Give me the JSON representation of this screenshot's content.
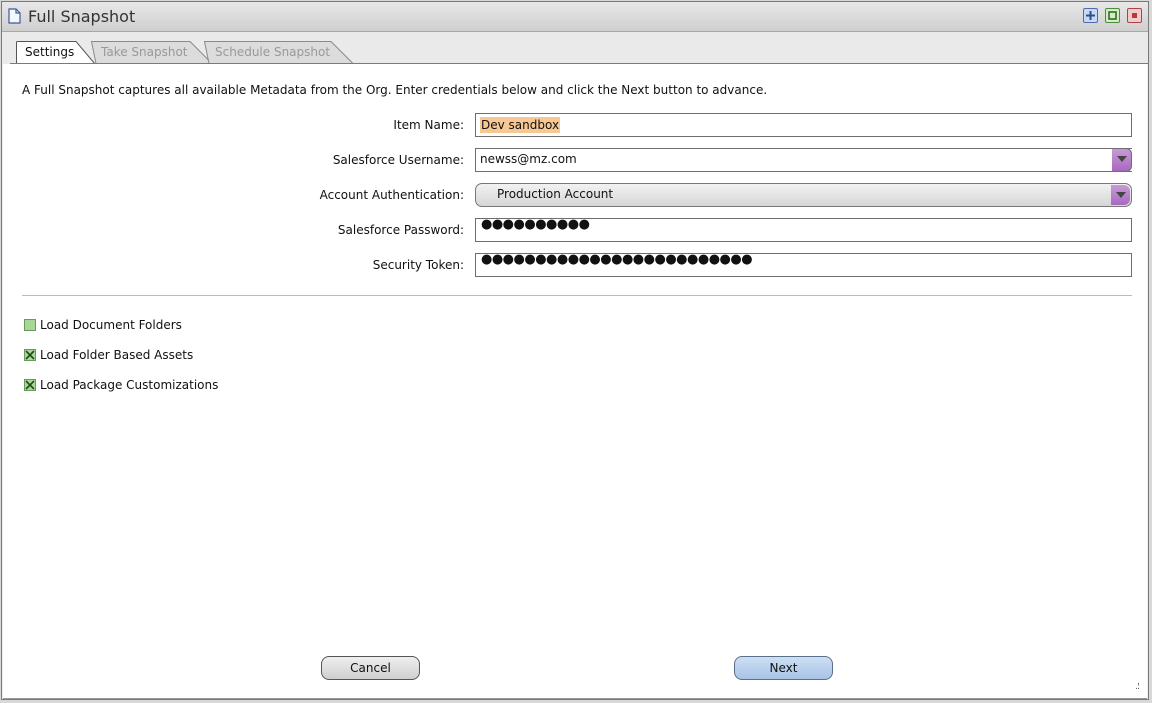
{
  "window": {
    "title": "Full Snapshot"
  },
  "tabs": [
    {
      "label": "Settings",
      "active": true
    },
    {
      "label": "Take Snapshot",
      "active": false
    },
    {
      "label": "Schedule Snapshot",
      "active": false
    }
  ],
  "intro": "A Full Snapshot captures all available Metadata from the Org. Enter credentials below and click the Next button to advance.",
  "form": {
    "item_name": {
      "label": "Item Name:",
      "value": "Dev sandbox"
    },
    "username": {
      "label": "Salesforce Username:",
      "value": "newss@mz.com"
    },
    "auth": {
      "label": "Account Authentication:",
      "value": "Production Account"
    },
    "password": {
      "label": "Salesforce Password:",
      "value": "●●●●●●●●●●"
    },
    "token": {
      "label": "Security Token:",
      "value": "●●●●●●●●●●●●●●●●●●●●●●●●●"
    }
  },
  "options": [
    {
      "label": "Load Document Folders",
      "checked": false
    },
    {
      "label": "Load Folder Based Assets",
      "checked": true
    },
    {
      "label": "Load Package Customizations",
      "checked": true
    }
  ],
  "buttons": {
    "cancel": "Cancel",
    "next": "Next"
  },
  "colors": {
    "accent_arrow": "#a868c0",
    "highlight": "#f7c894",
    "next_button": "#a8c4e6",
    "checkbox": "#a9d79a"
  },
  "icons": {
    "title": "document-icon",
    "resize": "resize-grip-icon"
  }
}
